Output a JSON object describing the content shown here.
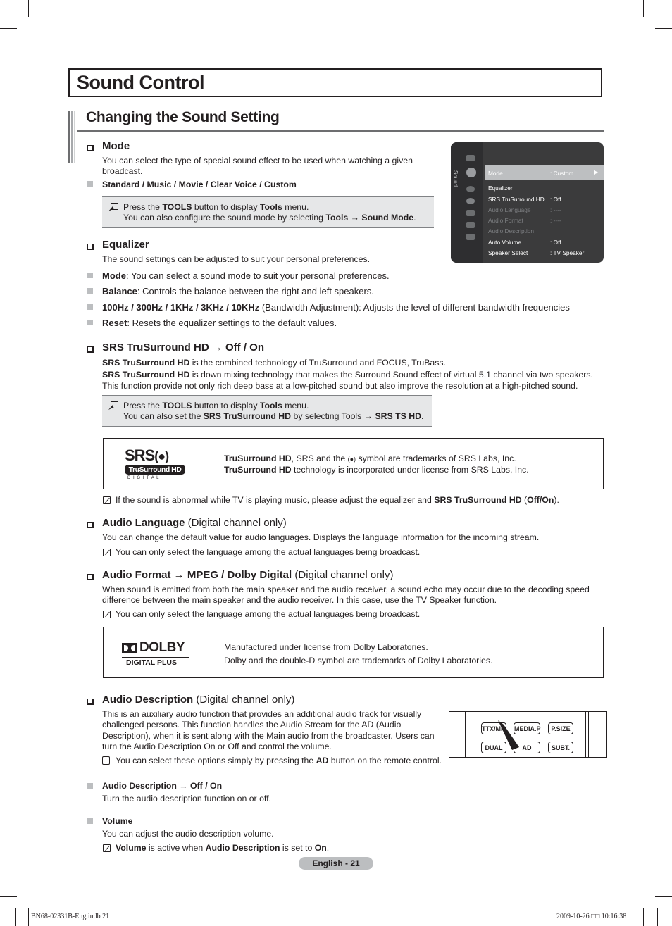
{
  "page": {
    "title": "Sound Control",
    "subtitle": "Changing the Sound Setting",
    "page_label": "English - 21",
    "footer_left": "BN68-02331B-Eng.indb   21",
    "footer_right": "2009-10-26   □□ 10:16:38"
  },
  "mode": {
    "heading": "Mode",
    "desc_1": "You can select the type of special sound effect to be used when watching a given",
    "desc_2": "broadcast.",
    "options": "Standard / Music / Movie / Clear Voice / Custom",
    "tools": {
      "l1_a": "Press the ",
      "l1_b": "TOOLS",
      "l1_c": " button to display ",
      "l1_d": "Tools",
      "l1_e": " menu.",
      "l2_a": "You can also configure the sound mode by selecting ",
      "l2_b": "Tools → Sound Mode",
      "l2_c": "."
    }
  },
  "tv_menu": {
    "category": "Sound",
    "items": [
      {
        "label": "Mode",
        "value": ": Custom",
        "state": "selected"
      },
      {
        "label": "Equalizer",
        "value": "",
        "state": "enabled"
      },
      {
        "label": "SRS TruSurround HD",
        "value": ": Off",
        "state": "enabled"
      },
      {
        "label": "Audio Language",
        "value": ": ----",
        "state": "disabled"
      },
      {
        "label": "Audio Format",
        "value": ": ----",
        "state": "disabled"
      },
      {
        "label": "Audio Description",
        "value": "",
        "state": "disabled"
      },
      {
        "label": "Auto Volume",
        "value": ": Off",
        "state": "enabled"
      },
      {
        "label": "Speaker Select",
        "value": ": TV Speaker",
        "state": "enabled"
      }
    ],
    "arrow": "▶"
  },
  "equalizer": {
    "heading": "Equalizer",
    "desc": "The sound settings can be adjusted to suit your personal preferences.",
    "bullets": [
      {
        "bold": "Mode",
        "text": ": You can select a sound mode to suit your personal preferences."
      },
      {
        "bold": "Balance",
        "text": ": Controls the balance between the right and left speakers."
      },
      {
        "bold": "100Hz / 300Hz / 1KHz / 3KHz / 10KHz",
        "text": " (Bandwidth Adjustment): Adjusts the level of different bandwidth frequencies"
      },
      {
        "bold": "Reset",
        "text": ": Resets the equalizer settings to the default values."
      }
    ]
  },
  "srs": {
    "heading": "SRS TruSurround HD → Off / On",
    "p1_b": "SRS TruSurround HD",
    "p1": " is the combined technology of TruSurround and FOCUS, TruBass.",
    "p2_b": "SRS TruSurround HD",
    "p2": " is down mixing technology that makes the Surround Sound effect of virtual 5.1 channel via two speakers.",
    "p3": "This function provide not only rich deep bass at a low-pitched sound but also improve the resolution at a high-pitched sound.",
    "tools": {
      "l1_a": "Press the ",
      "l1_b": "TOOLS",
      "l1_c": " button to display ",
      "l1_d": "Tools",
      "l1_e": " menu.",
      "l2_a": "You can also set the ",
      "l2_b": "SRS TruSurround HD",
      "l2_c": " by selecting Tools → ",
      "l2_d": "SRS TS HD",
      "l2_e": "."
    },
    "license": {
      "logo_top": "SRS",
      "logo_mid": "TruSurround HD",
      "logo_bottom": "D I G I T A L",
      "l1_b": "TruSurround HD",
      "l1": ", SRS and the ",
      "l1_sym": "(●)",
      "l1_c": " symbol are trademarks of SRS Labs, Inc.",
      "l2_b": "TruSurround HD",
      "l2": " technology is incorporated under license from SRS Labs, Inc."
    },
    "note_a": "If the sound is abnormal while TV is playing music, please adjust the equalizer and ",
    "note_b": "SRS TruSurround HD",
    "note_c": " (",
    "note_d": "Off/On",
    "note_e": ")."
  },
  "audio_language": {
    "heading": "Audio Language",
    "qual": " (Digital channel only)",
    "desc": "You can change the default value for audio languages. Displays the language information for the incoming stream.",
    "note": "You can only select the language among the actual languages being broadcast."
  },
  "audio_format": {
    "heading_a": "Audio Format",
    "heading_b": " → ",
    "heading_c": "MPEG / Dolby Digital",
    "qual": " (Digital channel only)",
    "desc_1": "When sound is emitted from both the main speaker and the audio receiver, a sound echo may occur due to the decoding speed",
    "desc_2": "difference between the main speaker and the audio receiver. In this case, use the TV Speaker function.",
    "note": "You can only select the language among the actual languages being broadcast.",
    "license": {
      "logo_top": "DOLBY",
      "logo_bottom": "DIGITAL PLUS",
      "l1": "Manufactured under license from Dolby Laboratories.",
      "l2": "Dolby and the double-D symbol are trademarks of Dolby Laboratories."
    }
  },
  "audio_description": {
    "heading": "Audio Description",
    "qual": " (Digital channel only)",
    "desc": [
      "This is an auxiliary audio function that provides an additional audio track for visually",
      "challenged persons. This function handles the Audio Stream for the AD (Audio",
      "Description), when it is sent along with the Main audio from the broadcaster. Users can",
      "turn the Audio Description On or Off and control the volume."
    ],
    "remote_note_a": "You can select these options simply by pressing the ",
    "remote_note_b": "AD",
    "remote_note_c": " button on the remote control.",
    "remote_buttons": [
      "TTX/MIX",
      "MEDIA.P",
      "P.SIZE",
      "DUAL",
      "AD",
      "SUBT."
    ],
    "sub1_heading": "Audio Description → Off / On",
    "sub1_desc": "Turn the audio description function on or off.",
    "sub2_heading": "Volume",
    "sub2_desc": "You can adjust the audio description volume.",
    "sub2_note_a": "Volume",
    "sub2_note_b": " is active when ",
    "sub2_note_c": "Audio Description",
    "sub2_note_d": " is set to ",
    "sub2_note_e": "On",
    "sub2_note_f": "."
  }
}
